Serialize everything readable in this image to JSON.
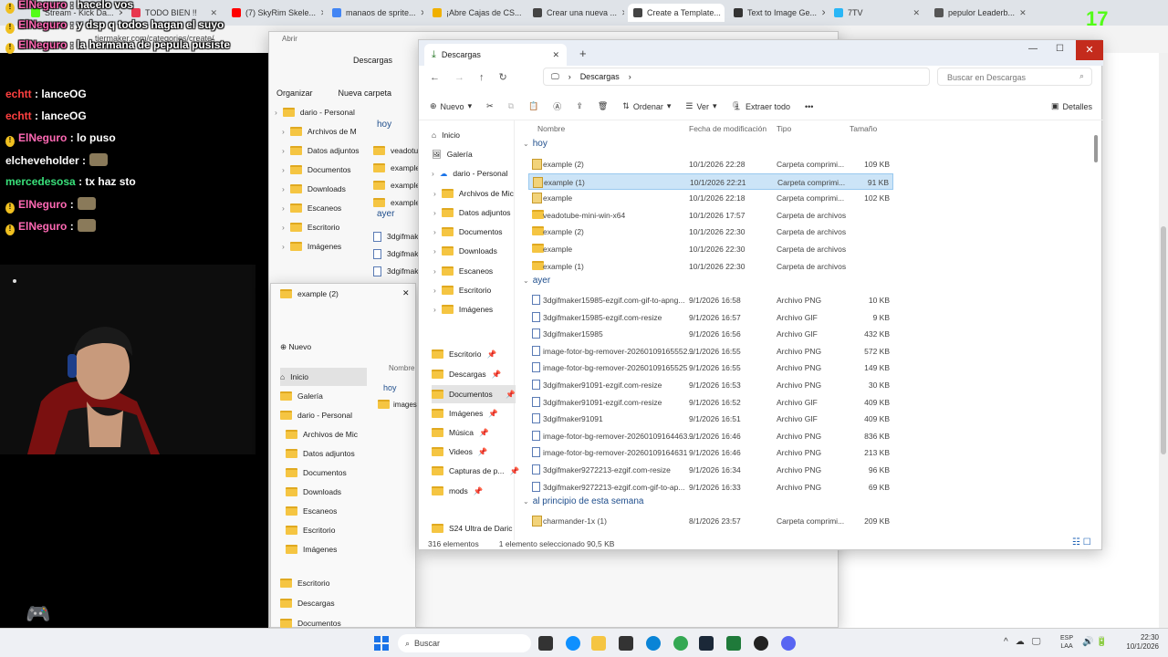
{
  "browser": {
    "tabs": [
      {
        "label": "Stream - Kick Da...",
        "color": "#53fc18"
      },
      {
        "label": "TODO BIEN !!",
        "color": "#e8384f"
      },
      {
        "label": "(7) SkyRim Skele...",
        "color": "#ff0000"
      },
      {
        "label": "manaos de sprite...",
        "color": "#4285f4"
      },
      {
        "label": "¡Abre Cajas de CS...",
        "color": "#f0b000"
      },
      {
        "label": "Crear una nueva ...",
        "color": "#444444"
      },
      {
        "label": "Create a Template...",
        "color": "#444444"
      },
      {
        "label": "Text to Image Ge...",
        "color": "#333333"
      },
      {
        "label": "7TV",
        "color": "#29b6f6"
      },
      {
        "label": "pepulor Leaderb...",
        "color": "#555555"
      }
    ],
    "address": "tiermaker.com/categories/create/"
  },
  "chat": [
    {
      "user": "ElNeguro",
      "color": "#ff69b4",
      "text": ": hacelo vos",
      "badge": true
    },
    {
      "user": "ElNeguro",
      "color": "#ff69b4",
      "text": ": y dsp q todos hagan el suyo",
      "badge": true
    },
    {
      "user": "ElNeguro",
      "color": "#ff69b4",
      "text": ": la hermana de pepula pusiste",
      "badge": true
    },
    {
      "user": "echtt",
      "color": "#ff4040",
      "text": ": lanceOG",
      "badge": false
    },
    {
      "user": "echtt",
      "color": "#ff4040",
      "text": ": lanceOG",
      "badge": false
    },
    {
      "user": "ElNeguro",
      "color": "#ff69b4",
      "text": ": lo puso",
      "badge": true
    },
    {
      "user": "elcheveholder",
      "color": "#ffffff",
      "text": ":",
      "badge": false
    },
    {
      "user": "mercedesosa",
      "color": "#39e07a",
      "text": ": tx haz sto",
      "badge": false
    },
    {
      "user": "ElNeguro",
      "color": "#ff69b4",
      "text": ":",
      "badge": true
    },
    {
      "user": "ElNeguro",
      "color": "#ff69b4",
      "text": ":",
      "badge": true
    }
  ],
  "overlay": {
    "counter": "17"
  },
  "back_window": {
    "tab": "Descargas",
    "toolbar": [
      "Organizar",
      "Nueva carpeta"
    ],
    "tree": [
      "dario - Personal",
      "Archivos de M",
      "Datos adjuntos",
      "Documentos",
      "Downloads",
      "Escaneos",
      "Escritorio",
      "Imágenes"
    ],
    "groups": [
      "hoy",
      "ayer"
    ],
    "files": [
      "veadotube",
      "example (2",
      "example",
      "example (",
      "3dgifmake",
      "3dgifmake",
      "3dgifmake"
    ]
  },
  "mid_window": {
    "tab": "example (2)",
    "new_label": "Nuevo",
    "col": "Nombre",
    "group": "hoy",
    "file": "images",
    "tree": [
      "Inicio",
      "Galería",
      "dario - Personal",
      "Archivos de Mic",
      "Datos adjuntos",
      "Documentos",
      "Downloads",
      "Escaneos",
      "Escritorio",
      "Imágenes",
      "Escritorio",
      "Descargas",
      "Documentos"
    ]
  },
  "explorer": {
    "tab": "Descargas",
    "breadcrumb": "Descargas",
    "search_placeholder": "Buscar en Descargas",
    "toolbar": {
      "new": "Nuevo",
      "sort": "Ordenar",
      "view": "Ver",
      "extract": "Extraer todo",
      "details": "Detalles"
    },
    "columns": [
      "Nombre",
      "Fecha de modificación",
      "Tipo",
      "Tamaño"
    ],
    "nav": [
      "Inicio",
      "Galería",
      "dario - Personal",
      "Archivos de Mic",
      "Datos adjuntos",
      "Documentos",
      "Downloads",
      "Escaneos",
      "Escritorio",
      "Imágenes",
      "Escritorio",
      "Descargas",
      "Documentos",
      "Imágenes",
      "Música",
      "Videos",
      "Capturas de p...",
      "mods",
      "S24 Ultra de Daric"
    ],
    "groups": [
      "hoy",
      "ayer",
      "al principio de esta semana"
    ],
    "rows": [
      {
        "name": "example (2)",
        "date": "10/1/2026 22:28",
        "type": "Carpeta comprimi...",
        "size": "109 KB",
        "kind": "zip",
        "sel": false
      },
      {
        "name": "example (1)",
        "date": "10/1/2026 22:21",
        "type": "Carpeta comprimi...",
        "size": "91 KB",
        "kind": "zip",
        "sel": true
      },
      {
        "name": "example",
        "date": "10/1/2026 22:18",
        "type": "Carpeta comprimi...",
        "size": "102 KB",
        "kind": "zip",
        "sel": false
      },
      {
        "name": "veadotube-mini-win-x64",
        "date": "10/1/2026 17:57",
        "type": "Carpeta de archivos",
        "size": "",
        "kind": "folder",
        "sel": false
      },
      {
        "name": "example (2)",
        "date": "10/1/2026 22:30",
        "type": "Carpeta de archivos",
        "size": "",
        "kind": "folder",
        "sel": false
      },
      {
        "name": "example",
        "date": "10/1/2026 22:30",
        "type": "Carpeta de archivos",
        "size": "",
        "kind": "folder",
        "sel": false
      },
      {
        "name": "example (1)",
        "date": "10/1/2026 22:30",
        "type": "Carpeta de archivos",
        "size": "",
        "kind": "folder",
        "sel": false
      },
      {
        "name": "3dgifmaker15985-ezgif.com-gif-to-apng...",
        "date": "9/1/2026 16:58",
        "type": "Archivo PNG",
        "size": "10 KB",
        "kind": "file",
        "sel": false
      },
      {
        "name": "3dgifmaker15985-ezgif.com-resize",
        "date": "9/1/2026 16:57",
        "type": "Archivo GIF",
        "size": "9 KB",
        "kind": "file",
        "sel": false
      },
      {
        "name": "3dgifmaker15985",
        "date": "9/1/2026 16:56",
        "type": "Archivo GIF",
        "size": "432 KB",
        "kind": "file",
        "sel": false
      },
      {
        "name": "image-fotor-bg-remover-20260109165552...",
        "date": "9/1/2026 16:55",
        "type": "Archivo PNG",
        "size": "572 KB",
        "kind": "file",
        "sel": false
      },
      {
        "name": "image-fotor-bg-remover-20260109165525",
        "date": "9/1/2026 16:55",
        "type": "Archivo PNG",
        "size": "149 KB",
        "kind": "file",
        "sel": false
      },
      {
        "name": "3dgifmaker91091-ezgif.com-resize",
        "date": "9/1/2026 16:53",
        "type": "Archivo PNG",
        "size": "30 KB",
        "kind": "file",
        "sel": false
      },
      {
        "name": "3dgifmaker91091-ezgif.com-resize",
        "date": "9/1/2026 16:52",
        "type": "Archivo GIF",
        "size": "409 KB",
        "kind": "file",
        "sel": false
      },
      {
        "name": "3dgifmaker91091",
        "date": "9/1/2026 16:51",
        "type": "Archivo GIF",
        "size": "409 KB",
        "kind": "file",
        "sel": false
      },
      {
        "name": "image-fotor-bg-remover-20260109164463...",
        "date": "9/1/2026 16:46",
        "type": "Archivo PNG",
        "size": "836 KB",
        "kind": "file",
        "sel": false
      },
      {
        "name": "image-fotor-bg-remover-20260109164631",
        "date": "9/1/2026 16:46",
        "type": "Archivo PNG",
        "size": "213 KB",
        "kind": "file",
        "sel": false
      },
      {
        "name": "3dgifmaker9272213-ezgif.com-resize",
        "date": "9/1/2026 16:34",
        "type": "Archivo PNG",
        "size": "96 KB",
        "kind": "file",
        "sel": false
      },
      {
        "name": "3dgifmaker9272213-ezgif.com-gif-to-ap...",
        "date": "9/1/2026 16:33",
        "type": "Archivo PNG",
        "size": "69 KB",
        "kind": "file",
        "sel": false
      },
      {
        "name": "charmander-1x (1)",
        "date": "8/1/2026 23:57",
        "type": "Carpeta comprimi...",
        "size": "209 KB",
        "kind": "zip",
        "sel": false
      }
    ],
    "status": {
      "count": "316 elementos",
      "selected": "1 elemento seleccionado  90,5 KB"
    }
  },
  "taskbar": {
    "search": "Buscar",
    "lang1": "ESP",
    "lang2": "LAA",
    "time": "22:30",
    "date": "10/1/2026"
  }
}
